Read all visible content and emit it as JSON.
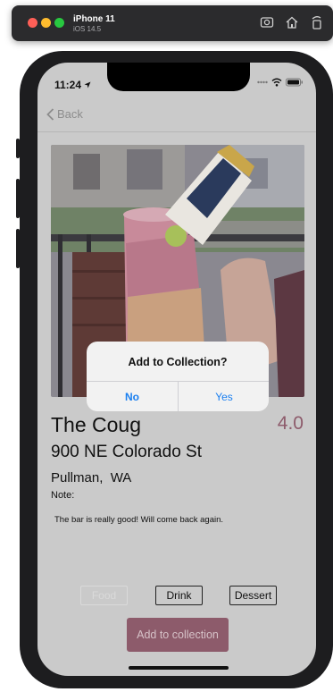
{
  "simulator": {
    "device": "iPhone 11",
    "os": "iOS 14.5",
    "icons": [
      "screenshot-icon",
      "home-icon",
      "rotate-icon"
    ]
  },
  "status_bar": {
    "time": "11:24"
  },
  "nav": {
    "back_label": "Back"
  },
  "place": {
    "name": "The Coug",
    "rating": "4.0",
    "street": "900 NE Colorado St",
    "city": "Pullman,  WA",
    "note_label": "Note:",
    "note": "The bar is really good! Will come back again."
  },
  "categories": [
    {
      "label": "Food",
      "enabled": false
    },
    {
      "label": "Drink",
      "enabled": true
    },
    {
      "label": "Dessert",
      "enabled": true
    }
  ],
  "add_button": {
    "label": "Add to collection"
  },
  "alert": {
    "title": "Add to Collection?",
    "no": "No",
    "yes": "Yes"
  },
  "colors": {
    "accent": "#8d5b6b",
    "alert_button": "#1a7ff0",
    "dim_background": "#cacaca"
  }
}
